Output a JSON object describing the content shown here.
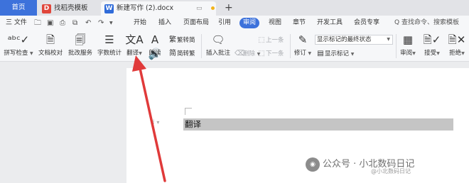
{
  "tabs": {
    "home": "首页",
    "template": "找稻壳模板",
    "document": "新建写作 (2).docx"
  },
  "menu": {
    "file": "三 文件",
    "items": [
      "开始",
      "插入",
      "页面布局",
      "引用",
      "审阅",
      "视图",
      "章节",
      "开发工具",
      "会员专享"
    ],
    "active_index": 4,
    "search": "Q 查找命令、搜索模板"
  },
  "ribbon": {
    "spellcheck": "拼写检查",
    "doc_proof": "文档校对",
    "batch_edit": "批改服务",
    "word_count": "字数统计",
    "translate": "翻译",
    "read_aloud": "朗读",
    "trad_conv": "繁转简",
    "simp_conv": "简转繁",
    "insert_comment": "插入批注",
    "delete": "删除",
    "prev": "上一条",
    "next": "下一条",
    "track_changes": "修订",
    "display_state": "显示标记的最终状态",
    "show_markup": "显示标记",
    "review": "审阅",
    "accept": "接受",
    "reject": "拒绝"
  },
  "document": {
    "text": "翻译"
  },
  "watermark": {
    "brand": "公众号 · 小北数码日记",
    "sub": "@小北数码日记"
  },
  "colors": {
    "accent": "#3d72db",
    "arrow": "#e03a3a",
    "selection": "#c5c5c5"
  }
}
